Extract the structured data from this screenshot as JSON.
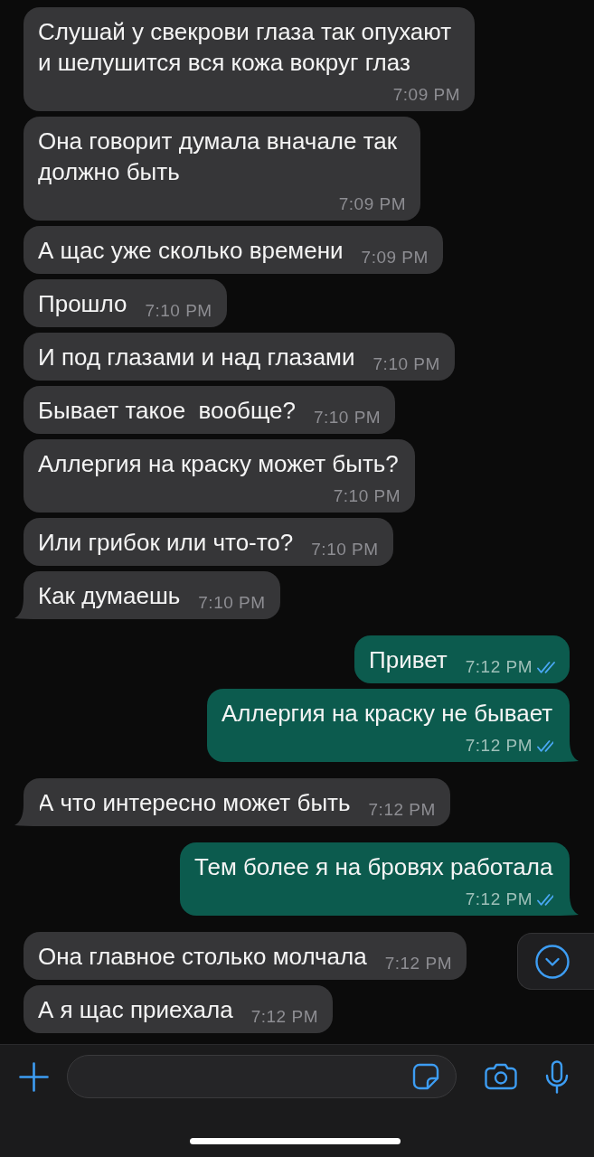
{
  "messages": [
    {
      "kind": "incoming",
      "text": "Слушай у свекрови глаза так опухают и шелушится вся кожа вокруг глаз",
      "time": "7:09 PM",
      "tail": false
    },
    {
      "kind": "incoming",
      "text": "Она говорит думала вначале так должно быть",
      "time": "7:09 PM",
      "tail": false
    },
    {
      "kind": "incoming",
      "text": "А щас уже сколько времени",
      "time": "7:09 PM",
      "tail": false
    },
    {
      "kind": "incoming",
      "text": "Прошло",
      "time": "7:10 PM",
      "tail": false
    },
    {
      "kind": "incoming",
      "text": "И под глазами и над глазами",
      "time": "7:10 PM",
      "tail": false
    },
    {
      "kind": "incoming",
      "text": "Бывает такое  вообще?",
      "time": "7:10 PM",
      "tail": false
    },
    {
      "kind": "incoming",
      "text": "Аллергия на краску может быть?",
      "time": "7:10 PM",
      "tail": false
    },
    {
      "kind": "incoming",
      "text": "Или грибок или что-то?",
      "time": "7:10 PM",
      "tail": false
    },
    {
      "kind": "incoming",
      "text": "Как думаешь",
      "time": "7:10 PM",
      "tail": true
    },
    {
      "kind": "outgoing",
      "text": "Привет",
      "time": "7:12 PM",
      "tail": false,
      "read": true
    },
    {
      "kind": "outgoing",
      "text": "Аллергия на краску не бывает",
      "time": "7:12 PM",
      "tail": true,
      "read": true
    },
    {
      "kind": "incoming",
      "text": "А что интересно может быть",
      "time": "7:12 PM",
      "tail": true
    },
    {
      "kind": "outgoing",
      "text": "Тем более я на бровях работала",
      "time": "7:12 PM",
      "tail": true,
      "read": true
    },
    {
      "kind": "incoming",
      "text": "Она главное столько молчала",
      "time": "7:12 PM",
      "tail": false
    },
    {
      "kind": "incoming",
      "text": "А я щас приехала",
      "time": "7:12 PM",
      "tail": false
    }
  ]
}
